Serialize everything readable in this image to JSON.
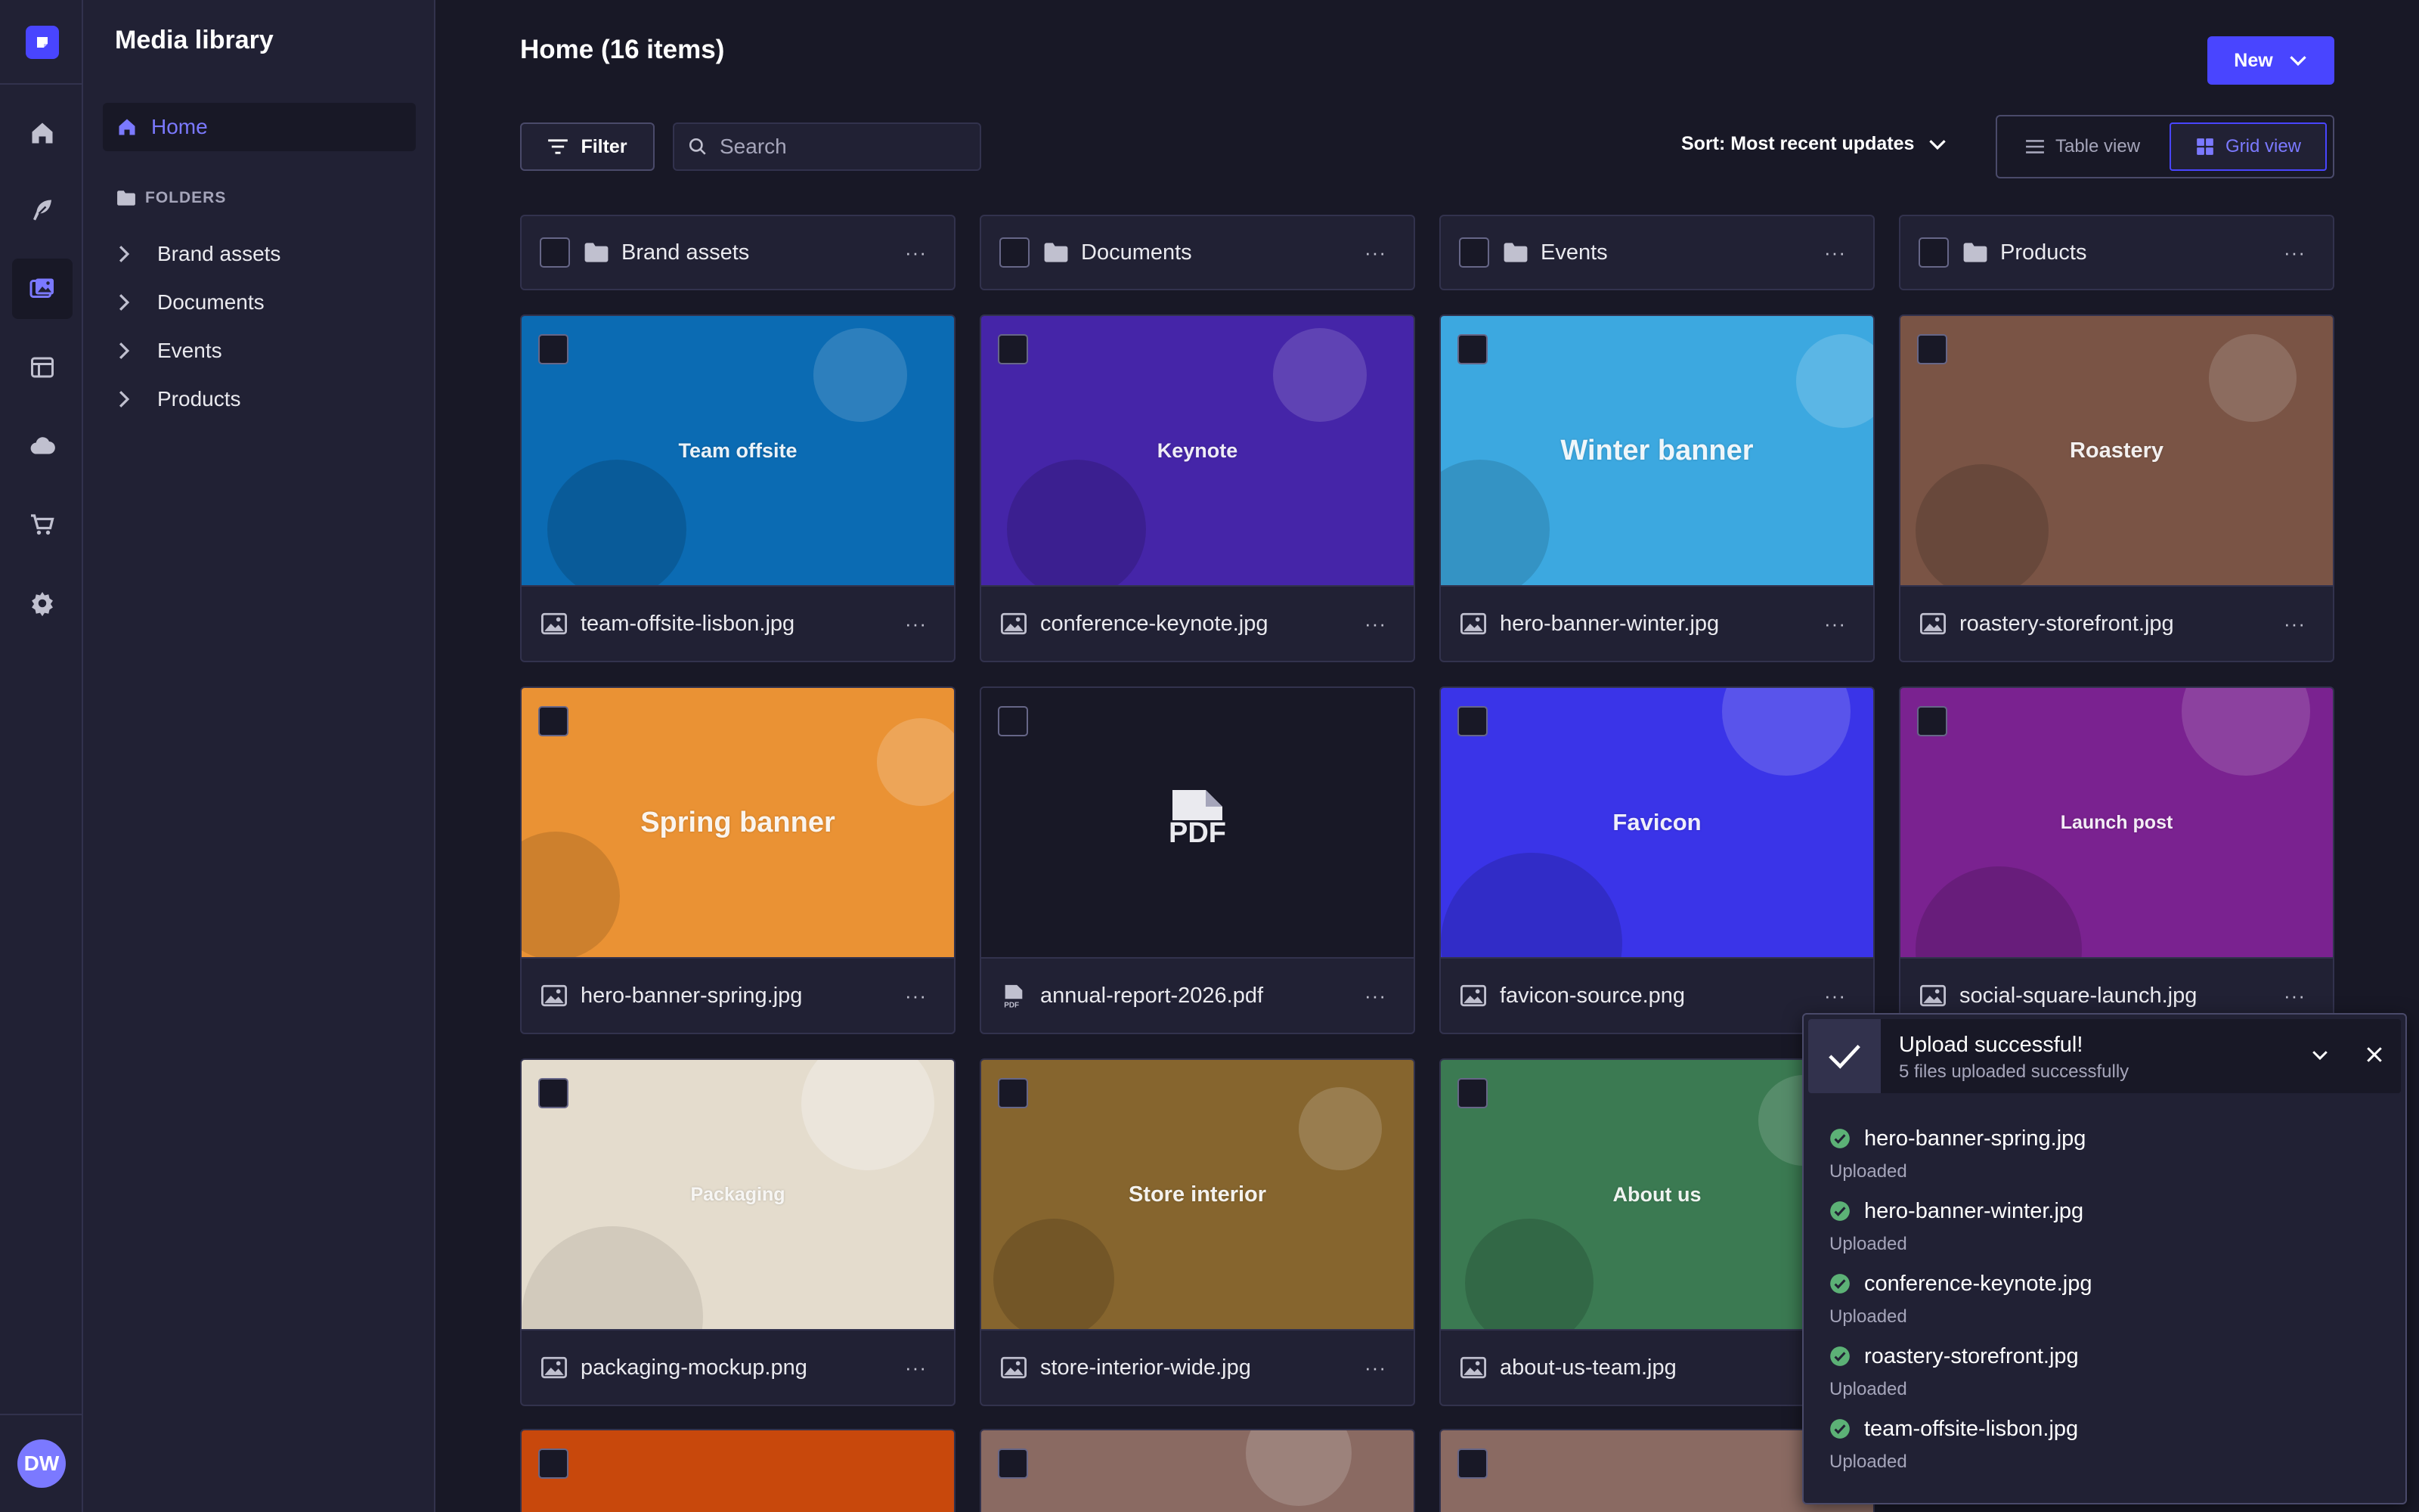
{
  "app": {
    "title": "Media library",
    "user_initials": "DW",
    "brand_color": "#4945ff"
  },
  "rail": {
    "items": [
      {
        "icon": "home-icon"
      },
      {
        "icon": "content-feather-icon"
      },
      {
        "icon": "media-library-icon",
        "active": true
      },
      {
        "icon": "layout-icon"
      },
      {
        "icon": "cloud-icon"
      },
      {
        "icon": "cart-icon"
      },
      {
        "icon": "gear-icon"
      }
    ]
  },
  "sidebar": {
    "home_label": "Home",
    "folders_heading": "FOLDERS",
    "folders": [
      "Brand assets",
      "Documents",
      "Events",
      "Products"
    ]
  },
  "header": {
    "title": "Home (16 items)",
    "new_label": "New",
    "filter_label": "Filter",
    "search_placeholder": "Search",
    "sort_label": "Sort: Most recent updates",
    "table_view_label": "Table view",
    "grid_view_label": "Grid view",
    "active_view": "grid"
  },
  "folders": [
    {
      "name": "Brand assets"
    },
    {
      "name": "Documents"
    },
    {
      "name": "Events"
    },
    {
      "name": "Products"
    }
  ],
  "assets": [
    {
      "filename": "team-offsite-lisbon.jpg",
      "preview_title": "Team offsite",
      "type": "image",
      "bg": "#0b6bb3"
    },
    {
      "filename": "conference-keynote.jpg",
      "preview_title": "Keynote",
      "type": "image",
      "bg": "#4525a8"
    },
    {
      "filename": "hero-banner-winter.jpg",
      "preview_title": "Winter banner",
      "type": "image",
      "bg": "#3ca8e0"
    },
    {
      "filename": "roastery-storefront.jpg",
      "preview_title": "Roastery",
      "type": "image",
      "bg": "#7a5445"
    },
    {
      "filename": "hero-banner-spring.jpg",
      "preview_title": "Spring banner",
      "type": "image",
      "bg": "#ea9234"
    },
    {
      "filename": "annual-report-2026.pdf",
      "preview_title": "PDF",
      "type": "pdf",
      "bg": "#181826"
    },
    {
      "filename": "favicon-source.png",
      "preview_title": "Favicon",
      "type": "image",
      "bg": "#3a34e8"
    },
    {
      "filename": "social-square-launch.jpg",
      "preview_title": "Launch post",
      "type": "image",
      "bg": "#7a2290"
    },
    {
      "filename": "packaging-mockup.png",
      "preview_title": "Packaging",
      "type": "image",
      "bg": "#e4dccd"
    },
    {
      "filename": "store-interior-wide.jpg",
      "preview_title": "Store interior",
      "type": "image",
      "bg": "#86652e"
    },
    {
      "filename": "about-us-team.jpg",
      "preview_title": "About us",
      "type": "image",
      "bg": "#3b7a52"
    }
  ],
  "partial_row": [
    {
      "bg": "#c8480c"
    },
    {
      "bg": "#8a6a62"
    },
    {
      "bg": "#8a6a62"
    }
  ],
  "toast": {
    "title": "Upload successful!",
    "subtitle": "5 files uploaded successfully",
    "success_color": "#5cb176",
    "files": [
      {
        "name": "hero-banner-spring.jpg",
        "status": "Uploaded"
      },
      {
        "name": "hero-banner-winter.jpg",
        "status": "Uploaded"
      },
      {
        "name": "conference-keynote.jpg",
        "status": "Uploaded"
      },
      {
        "name": "roastery-storefront.jpg",
        "status": "Uploaded"
      },
      {
        "name": "team-offsite-lisbon.jpg",
        "status": "Uploaded"
      }
    ]
  }
}
